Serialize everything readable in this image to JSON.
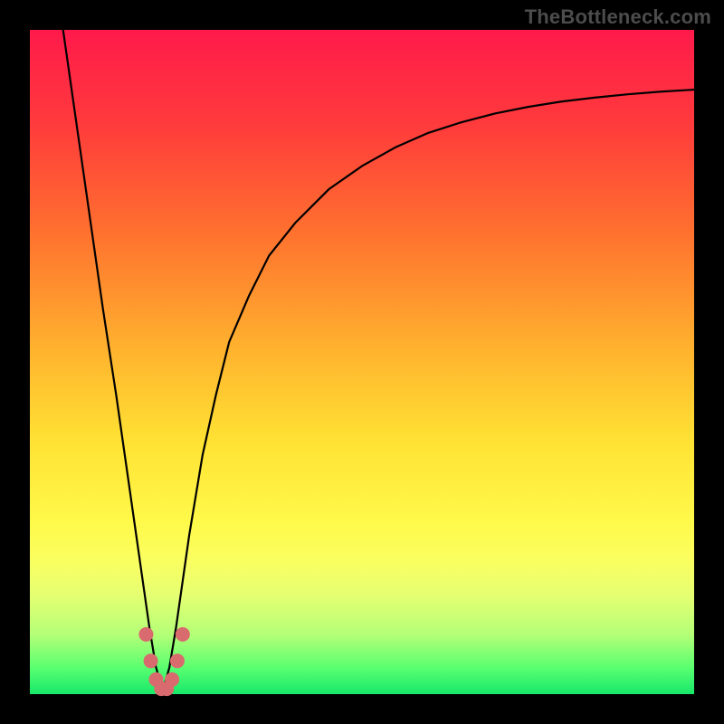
{
  "watermark": "TheBottleneck.com",
  "plot": {
    "inner_left": 33,
    "inner_top": 33,
    "inner_size": 734
  },
  "colors": {
    "gradient_stops": [
      {
        "pct": 0,
        "color": "#ff1a4b"
      },
      {
        "pct": 14,
        "color": "#ff3a3c"
      },
      {
        "pct": 30,
        "color": "#ff6f2f"
      },
      {
        "pct": 48,
        "color": "#ffb22e"
      },
      {
        "pct": 62,
        "color": "#ffe233"
      },
      {
        "pct": 74,
        "color": "#fff94a"
      },
      {
        "pct": 80,
        "color": "#faff60"
      },
      {
        "pct": 85,
        "color": "#e6ff72"
      },
      {
        "pct": 91,
        "color": "#b4ff77"
      },
      {
        "pct": 96,
        "color": "#5aff70"
      },
      {
        "pct": 100,
        "color": "#17e86a"
      }
    ],
    "curve": "#000000",
    "markers": "#d96a6e"
  },
  "chart_data": {
    "type": "line",
    "title": "",
    "xlabel": "",
    "ylabel": "",
    "xlim": [
      0,
      100
    ],
    "ylim": [
      0,
      100
    ],
    "note": "V-shaped bottleneck/dip curve; minimum near x≈20. Y reads as percentage (0 bottom → 100 top). Values estimated from pixels.",
    "series": [
      {
        "name": "curve",
        "x": [
          5,
          7,
          9,
          11,
          13,
          15,
          16,
          17,
          18,
          19,
          20,
          21,
          22,
          23,
          24,
          26,
          28,
          30,
          33,
          36,
          40,
          45,
          50,
          55,
          60,
          65,
          70,
          75,
          80,
          85,
          90,
          95,
          100
        ],
        "y": [
          100,
          86,
          72,
          58,
          45,
          31,
          24,
          17,
          10,
          4,
          0.5,
          4,
          10,
          17,
          24,
          36,
          45,
          53,
          60,
          66,
          71,
          76,
          79.5,
          82.3,
          84.5,
          86.1,
          87.4,
          88.4,
          89.2,
          89.8,
          90.3,
          90.7,
          91
        ]
      }
    ],
    "markers": {
      "name": "highlight-cluster",
      "note": "Rounded salmon markers clustered at the dip bottom",
      "points": [
        {
          "x": 17.5,
          "y": 9
        },
        {
          "x": 18.2,
          "y": 5
        },
        {
          "x": 19.0,
          "y": 2.2
        },
        {
          "x": 19.8,
          "y": 0.8
        },
        {
          "x": 20.6,
          "y": 0.8
        },
        {
          "x": 21.4,
          "y": 2.2
        },
        {
          "x": 22.2,
          "y": 5
        },
        {
          "x": 23.0,
          "y": 9
        }
      ]
    }
  }
}
